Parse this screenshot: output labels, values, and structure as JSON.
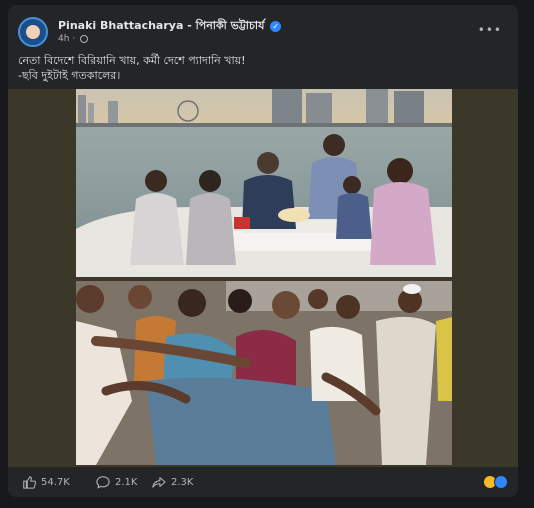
{
  "post": {
    "author": "Pinaki Bhattacharya - পিনাকী ভট্টাচার্য",
    "time": "4h",
    "separator": "·",
    "text_lines": [
      "নেতা বিদেশে বিরিয়ানি খায়, কর্মী দেশে প্যাদানি খায়!",
      "-ছবি দুইটাই গতকালের।"
    ]
  },
  "actions": {
    "likes": "54.7K",
    "comments": "2.1K",
    "shares": "2.3K"
  },
  "icons": {
    "verified": "verified-badge-icon",
    "audience": "globe-icon",
    "like": "thumbs-up-icon",
    "comment": "comment-bubble-icon",
    "share": "share-arrow-icon",
    "reactions": [
      "laugh-reaction-icon",
      "like-reaction-icon"
    ]
  },
  "colors": {
    "background": "#18191a",
    "card": "#242526",
    "text_primary": "#e4e6eb",
    "text_secondary": "#b0b3b8",
    "verified_blue": "#2d88ff"
  }
}
